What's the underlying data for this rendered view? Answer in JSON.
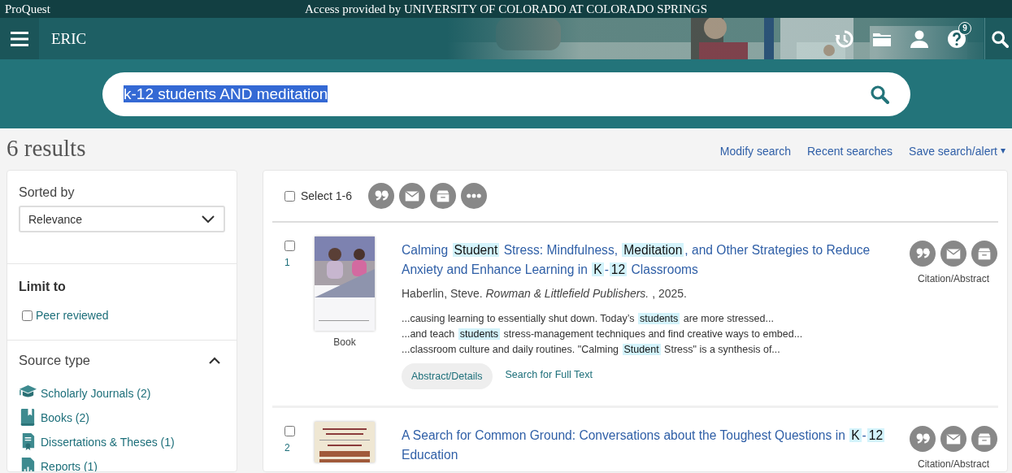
{
  "top_bar": {
    "brand": "ProQuest",
    "access_note": "Access provided by UNIVERSITY OF COLORADO AT COLORADO SPRINGS"
  },
  "nav": {
    "database": "ERIC",
    "help_badge": "9"
  },
  "search": {
    "query": "k-12 students AND meditation",
    "highlighted": true
  },
  "results_header": {
    "count": "6 results",
    "links": [
      "Modify search",
      "Recent searches",
      "Save search/alert"
    ]
  },
  "sidebar": {
    "sort": {
      "label": "Sorted by",
      "value": "Relevance"
    },
    "limit": {
      "title": "Limit to",
      "options": [
        {
          "label": "Peer reviewed",
          "checked": false
        }
      ]
    },
    "source_type": {
      "title": "Source type",
      "expanded": true,
      "items": [
        {
          "kind": "journal",
          "label": "Scholarly Journals (2)"
        },
        {
          "kind": "book",
          "label": "Books (2)"
        },
        {
          "kind": "dissertation",
          "label": "Dissertations & Theses (1)"
        },
        {
          "kind": "report",
          "label": "Reports (1)"
        }
      ]
    }
  },
  "results": {
    "select_all": {
      "label": "Select 1-6",
      "checked": false
    },
    "items": [
      {
        "number": "1",
        "selected": false,
        "format": "Book",
        "title": [
          {
            "text": "Calming ",
            "hit": false
          },
          {
            "text": "Student",
            "hit": true
          },
          {
            "text": " Stress: Mindfulness, ",
            "hit": false
          },
          {
            "text": "Meditation",
            "hit": true
          },
          {
            "text": ", and Other Strategies to Reduce Anxiety and Enhance Learning in ",
            "hit": false
          },
          {
            "text": "K",
            "hit": true
          },
          {
            "text": "-",
            "hit": false
          },
          {
            "text": "12",
            "hit": true
          },
          {
            "text": " Classrooms",
            "hit": false
          }
        ],
        "byline": "Haberlin, Steve.  *Rowman & Littlefield Publishers.* , 2025.",
        "snippets": [
          [
            {
              "text": "...causing learning to essentially shut down. Today’s ",
              "hit": false
            },
            {
              "text": "students",
              "hit": true
            },
            {
              "text": " are more stressed...",
              "hit": false
            }
          ],
          [
            {
              "text": "...and teach ",
              "hit": false
            },
            {
              "text": "students",
              "hit": true
            },
            {
              "text": " stress-management techniques and find creative ways to embed...",
              "hit": false
            }
          ],
          [
            {
              "text": "...classroom culture and daily routines. \"Calming ",
              "hit": false
            },
            {
              "text": "Student",
              "hit": true
            },
            {
              "text": " Stress\" is a synthesis of...",
              "hit": false
            }
          ]
        ],
        "actions": [
          {
            "kind": "pill",
            "label": "Abstract/Details"
          },
          {
            "kind": "link",
            "label": "Search for Full Text"
          }
        ],
        "tools_label": "Citation/Abstract"
      },
      {
        "number": "2",
        "selected": false,
        "title": [
          {
            "text": "A Search for Common Ground: Conversations about the Toughest Questions in ",
            "hit": false
          },
          {
            "text": "K",
            "hit": true
          },
          {
            "text": "-",
            "hit": false
          },
          {
            "text": "12",
            "hit": true
          },
          {
            "text": " Education",
            "hit": false
          }
        ],
        "tools_label": "Citation/Abstract"
      }
    ]
  }
}
